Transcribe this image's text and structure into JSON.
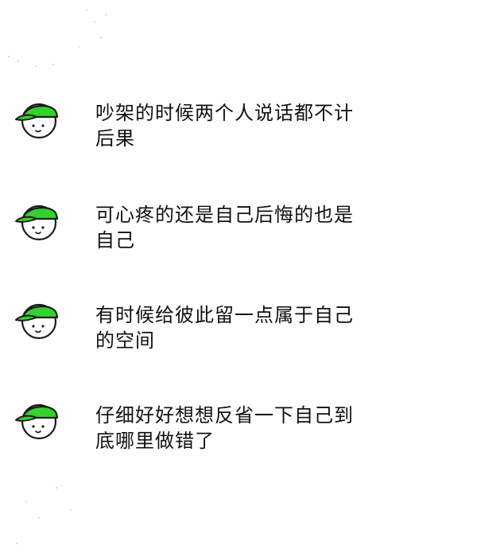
{
  "messages": [
    {
      "avatar_icon": "green-cap-face-icon",
      "line1": "吵架的时候两个人说话都不计",
      "line2": "后果"
    },
    {
      "avatar_icon": "green-cap-face-icon",
      "line1": "可心疼的还是自己后悔的也是",
      "line2": "自己"
    },
    {
      "avatar_icon": "green-cap-face-icon",
      "line1": "有时候给彼此留一点属于自己",
      "line2": "的空间"
    },
    {
      "avatar_icon": "green-cap-face-icon",
      "line1": "仔细好好想想反省一下自己到",
      "line2": "底哪里做错了"
    }
  ],
  "colors": {
    "cap_green": "#35d12e",
    "cap_outline": "#1a1a1a",
    "text": "#111111",
    "background": "#ffffff"
  }
}
